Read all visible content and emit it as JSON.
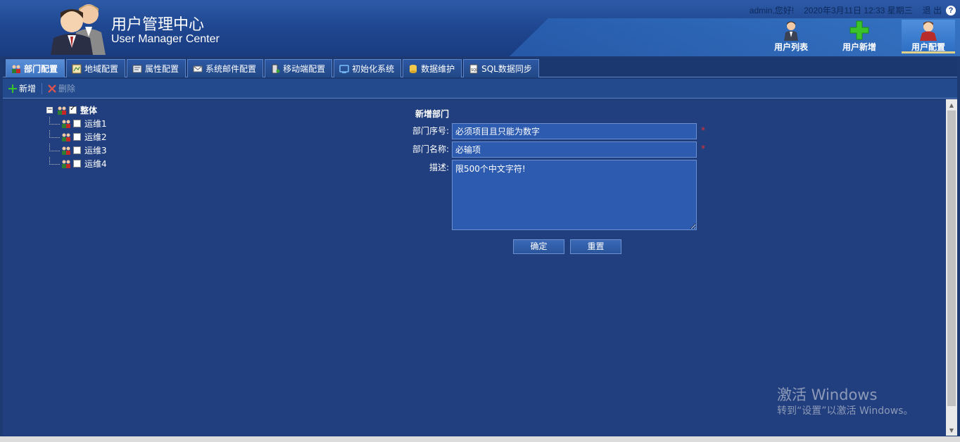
{
  "header": {
    "title_cn": "用户管理中心",
    "title_en": "User Manager Center",
    "greeting": "admin,您好!",
    "datetime": "2020年3月11日 12:33 星期三",
    "logout": "退 出",
    "help": "?",
    "nav": [
      {
        "label": "用户列表",
        "icon": "user-icon"
      },
      {
        "label": "用户新增",
        "icon": "plus-icon"
      },
      {
        "label": "用户配置",
        "icon": "user-config-icon",
        "active": true
      }
    ]
  },
  "tabs": [
    {
      "label": "部门配置",
      "icon": "department-icon",
      "active": true
    },
    {
      "label": "地域配置",
      "icon": "region-icon"
    },
    {
      "label": "属性配置",
      "icon": "attribute-icon"
    },
    {
      "label": "系统邮件配置",
      "icon": "mail-icon"
    },
    {
      "label": "移动端配置",
      "icon": "mobile-icon"
    },
    {
      "label": "初始化系统",
      "icon": "init-icon"
    },
    {
      "label": "数据维护",
      "icon": "database-icon"
    },
    {
      "label": "SQL数据同步",
      "icon": "sql-sync-icon"
    }
  ],
  "toolbar": {
    "add_label": "新增",
    "delete_label": "删除"
  },
  "tree": {
    "root": {
      "label": "整体",
      "checked": true,
      "expanded": true
    },
    "children": [
      {
        "label": "运维1",
        "checked": false
      },
      {
        "label": "运维2",
        "checked": false
      },
      {
        "label": "运维3",
        "checked": false
      },
      {
        "label": "运维4",
        "checked": false
      }
    ]
  },
  "form": {
    "title": "新增部门",
    "seq_label": "部门序号:",
    "seq_value": "必须项目且只能为数字",
    "name_label": "部门名称:",
    "name_value": "必输项",
    "desc_label": "描述:",
    "desc_value": "限500个中文字符!",
    "required_mark": "*",
    "ok_label": "确定",
    "reset_label": "重置"
  },
  "watermark": {
    "line1": "激活 Windows",
    "line2": "转到“设置”以激活 Windows。"
  },
  "colors": {
    "background": "#1e3a73",
    "header": "#1f4690",
    "input_bg": "#2d5bb0",
    "required": "#e53030"
  }
}
